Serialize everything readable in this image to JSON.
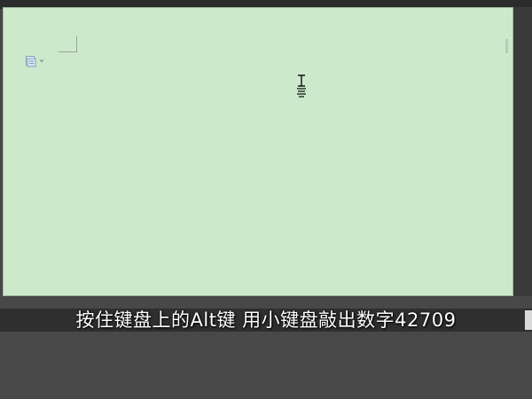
{
  "document": {
    "background_color": "#cde9cc"
  },
  "icons": {
    "paste_options": "paste-options-icon",
    "text_cursor": "ibeam-cursor-icon"
  },
  "subtitle": {
    "text": "按住键盘上的Alt键 用小键盘敲出数字42709"
  }
}
